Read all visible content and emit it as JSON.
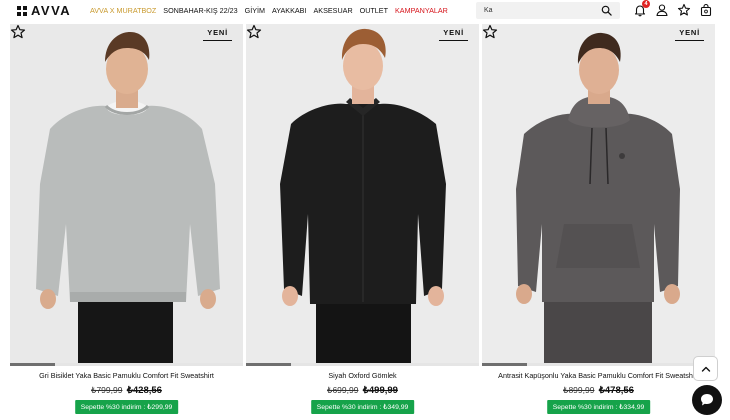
{
  "header": {
    "logo_text": "AVVA",
    "nav": [
      {
        "label": "AVVA X MURATBOZ",
        "variant": "collab"
      },
      {
        "label": "SONBAHAR-KIŞ 22/23",
        "variant": "normal"
      },
      {
        "label": "GİYİM",
        "variant": "normal"
      },
      {
        "label": "AYAKKABI",
        "variant": "normal"
      },
      {
        "label": "AKSESUAR",
        "variant": "normal"
      },
      {
        "label": "OUTLET",
        "variant": "normal"
      },
      {
        "label": "KAMPANYALAR",
        "variant": "sale"
      }
    ],
    "search": {
      "value": "Ka",
      "icon": "search-icon"
    },
    "icons": [
      "bell-icon",
      "user-icon",
      "star-icon",
      "bag-icon"
    ],
    "notification_count": "4"
  },
  "colors": {
    "collab": "#c99a2e",
    "sale": "#d6141b",
    "promo": "#16a34a",
    "badge": "#e02424"
  },
  "products": [
    {
      "badge": "YENİ",
      "name": "Gri Bisiklet Yaka Basic Pamuklu Comfort Fit Sweatshirt",
      "old_price": "₺799,99",
      "price": "₺428,56",
      "promo": "Sepette %30 indirim : ₺299,99",
      "garment": "grey crew-neck sweatshirt"
    },
    {
      "badge": "YENİ",
      "name": "Siyah Oxford Gömlek",
      "old_price": "₺699,99",
      "price": "₺499,99",
      "promo": "Sepette %30 indirim : ₺349,99",
      "garment": "black oxford shirt"
    },
    {
      "badge": "YENİ",
      "name": "Antrasit Kapüşonlu Yaka Basic Pamuklu Comfort Fit Sweatshirt",
      "old_price": "₺899,99",
      "price": "₺478,56",
      "promo": "Sepette %30 indirim : ₺334,99",
      "garment": "anthracite hoodie"
    }
  ],
  "floating": {
    "to_top_icon": "chevron-up-icon",
    "chat_icon": "chat-icon"
  }
}
